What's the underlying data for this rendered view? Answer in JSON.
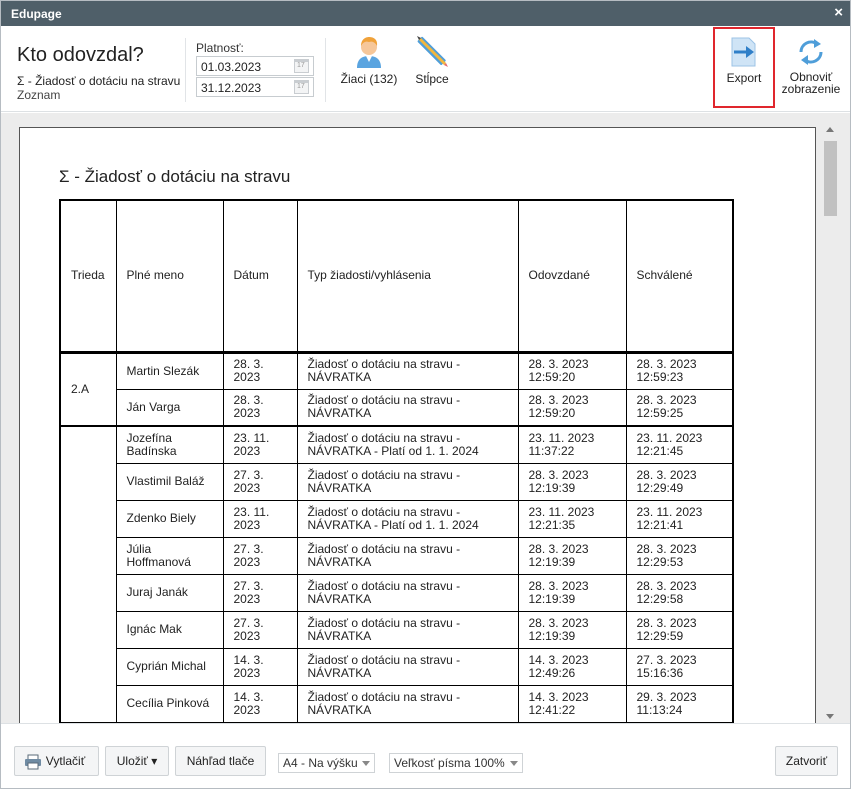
{
  "window": {
    "title": "Edupage",
    "close_glyph": "×"
  },
  "header": {
    "title": "Kto odovzdal?",
    "subtitle": "Σ - Žiadosť o dotáciu na stravu",
    "view": "Zoznam"
  },
  "validity": {
    "label": "Platnosť:",
    "from": "01.03.2023",
    "to": "31.12.2023"
  },
  "toolbar": {
    "students_label": "Žiaci (132)",
    "columns_label": "Stĺpce",
    "export_label": "Export",
    "refresh_label_1": "Obnoviť",
    "refresh_label_2": "zobrazenie"
  },
  "report": {
    "title": "Σ - Žiadosť o dotáciu na stravu",
    "columns": [
      "Trieda",
      "Plné meno",
      "Dátum",
      "Typ žiadosti/vyhlásenia",
      "Odovzdané",
      "Schválené"
    ],
    "groups": [
      {
        "class": "2.A",
        "rows": [
          {
            "name": "Martin Slezák",
            "date": "28. 3. 2023",
            "type": "Žiadosť o dotáciu na stravu - NÁVRATKA",
            "submitted": "28. 3. 2023 12:59:20",
            "approved": "28. 3. 2023 12:59:23"
          },
          {
            "name": "Ján Varga",
            "date": "28. 3. 2023",
            "type": "Žiadosť o dotáciu na stravu - NÁVRATKA",
            "submitted": "28. 3. 2023 12:59:20",
            "approved": "28. 3. 2023 12:59:25"
          }
        ]
      },
      {
        "class": "",
        "rows": [
          {
            "name": "Jozefína Badínska",
            "date": "23. 11. 2023",
            "type": "Žiadosť o dotáciu na stravu - NÁVRATKA - Platí od 1. 1. 2024",
            "submitted": "23. 11. 2023 11:37:22",
            "approved": "23. 11. 2023 12:21:45"
          },
          {
            "name": "Vlastimil Baláž",
            "date": "27. 3. 2023",
            "type": "Žiadosť o dotáciu na stravu - NÁVRATKA",
            "submitted": "28. 3. 2023 12:19:39",
            "approved": "28. 3. 2023 12:29:49"
          },
          {
            "name": "Zdenko Biely",
            "date": "23. 11. 2023",
            "type": "Žiadosť o dotáciu na stravu - NÁVRATKA - Platí od 1. 1. 2024",
            "submitted": "23. 11. 2023 12:21:35",
            "approved": "23. 11. 2023 12:21:41"
          },
          {
            "name": "Júlia Hoffmanová",
            "date": "27. 3. 2023",
            "type": "Žiadosť o dotáciu na stravu - NÁVRATKA",
            "submitted": "28. 3. 2023 12:19:39",
            "approved": "28. 3. 2023 12:29:53"
          },
          {
            "name": "Juraj Janák",
            "date": "27. 3. 2023",
            "type": "Žiadosť o dotáciu na stravu - NÁVRATKA",
            "submitted": "28. 3. 2023 12:19:39",
            "approved": "28. 3. 2023 12:29:58"
          },
          {
            "name": "Ignác Mak",
            "date": "27. 3. 2023",
            "type": "Žiadosť o dotáciu na stravu - NÁVRATKA",
            "submitted": "28. 3. 2023 12:19:39",
            "approved": "28. 3. 2023 12:29:59"
          },
          {
            "name": "Cyprián Michal",
            "date": "14. 3. 2023",
            "type": "Žiadosť o dotáciu na stravu - NÁVRATKA",
            "submitted": "14. 3. 2023 12:49:26",
            "approved": "27. 3. 2023 15:16:36"
          },
          {
            "name": "Cecília Pinková",
            "date": "14. 3. 2023",
            "type": "Žiadosť o dotáciu na stravu - NÁVRATKA",
            "submitted": "14. 3. 2023 12:41:22",
            "approved": "29. 3. 2023 11:13:24"
          }
        ]
      }
    ]
  },
  "footer": {
    "print_label": "Vytlačiť",
    "save_label": "Uložiť ▾",
    "preview_label": "Náhľad tlače",
    "orientation_value": "A4 - Na výšku",
    "font_size_value": "Veľkosť písma 100%",
    "close_label": "Zatvoriť"
  }
}
